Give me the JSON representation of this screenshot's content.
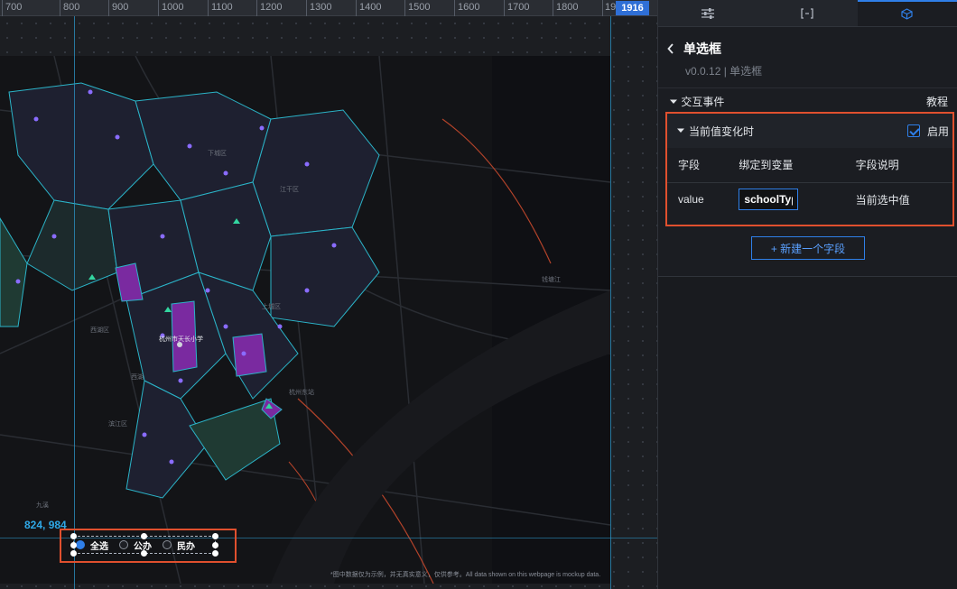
{
  "ruler": {
    "ticks": [
      "700",
      "800",
      "900",
      "1000",
      "1100",
      "1200",
      "1300",
      "1400",
      "1500",
      "1600",
      "1700",
      "1800",
      "19"
    ],
    "badge": "1916"
  },
  "canvas": {
    "coord_readout": "824, 984",
    "disclaimer": "*图中数据仅为示例，并无真实意义，仅供参考。All data shown on this webpage is mockup data."
  },
  "radio_widget": {
    "options": [
      {
        "label": "全选",
        "selected": true
      },
      {
        "label": "公办",
        "selected": false
      },
      {
        "label": "民办",
        "selected": false
      }
    ]
  },
  "map_labels": {
    "center_label": "杭州市天长小学",
    "places": [
      "西湖",
      "西湖区",
      "江干区",
      "下城区",
      "上城区",
      "杭州东站",
      "钱塘江",
      "九溪",
      "滨江区"
    ]
  },
  "panel": {
    "tabs": [
      {
        "icon": "sliders-icon",
        "active": false
      },
      {
        "icon": "bracket-icon",
        "active": false
      },
      {
        "icon": "cube-icon",
        "active": true
      }
    ],
    "component_name": "单选框",
    "component_meta": "v0.0.12 | 单选框",
    "section_title": "交互事件",
    "tutorial_link": "教程",
    "event": {
      "name": "当前值变化时",
      "enable_label": "启用",
      "enabled": true,
      "columns": [
        "字段",
        "绑定到变量",
        "字段说明"
      ],
      "rows": [
        {
          "field": "value",
          "variable": "schoolType",
          "description": "当前选中值"
        }
      ]
    },
    "add_field_label": "+ 新建一个字段"
  },
  "colors": {
    "accent": "#2f7fe8",
    "highlight_border": "#e0502e",
    "map_boundary": "#2bb4c8",
    "map_fill_purple": "#7a2aa0"
  }
}
